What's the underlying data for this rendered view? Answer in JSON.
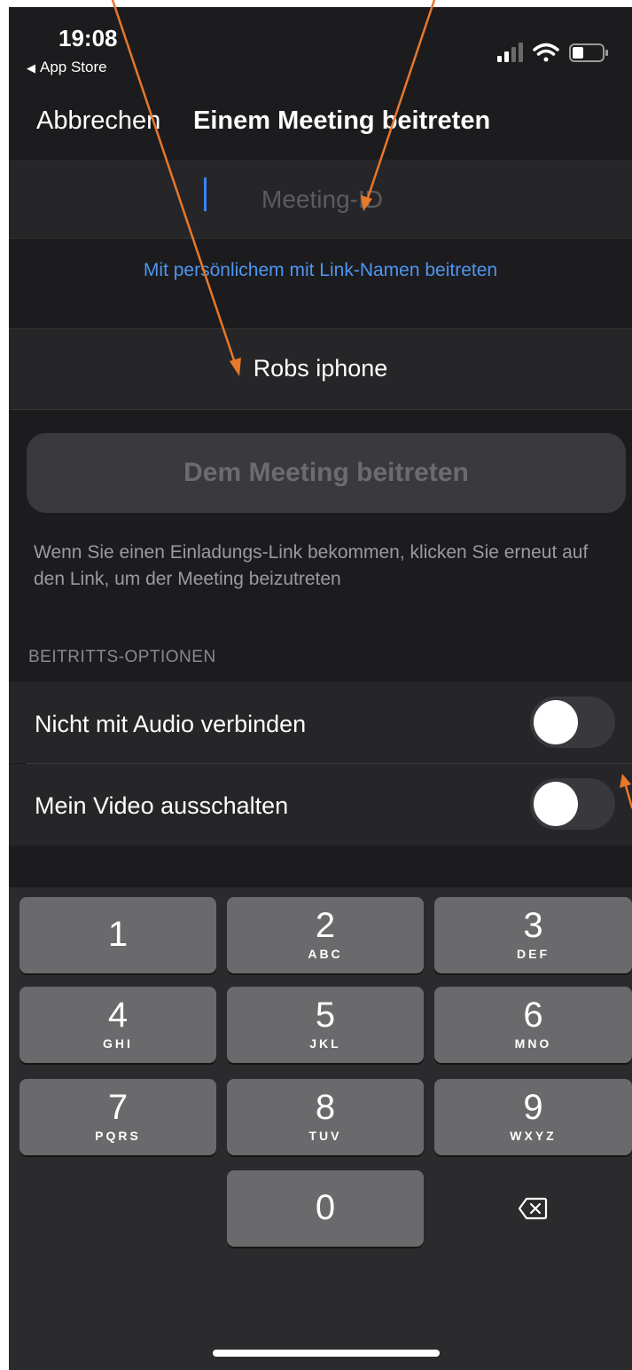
{
  "status_bar": {
    "time": "19:08",
    "back_label": "App Store",
    "back_icon": "◀"
  },
  "nav": {
    "cancel_label": "Abbrechen",
    "title": "Einem Meeting beitreten"
  },
  "meeting_id": {
    "placeholder": "Meeting-ID",
    "value": ""
  },
  "link_name_label": "Mit persönlichem mit Link-Namen beitreten",
  "display_name": "Robs iphone",
  "join_button_label": "Dem Meeting beitreten",
  "hint_text": "Wenn Sie einen Einladungs-Link bekommen, klicken Sie erneut auf den Link, um der Meeting beizutreten",
  "options": {
    "header": "BEITRITTS-OPTIONEN",
    "items": [
      {
        "label": "Nicht mit Audio verbinden",
        "enabled": false
      },
      {
        "label": "Mein Video ausschalten",
        "enabled": false
      }
    ]
  },
  "keypad": {
    "keys": [
      {
        "digit": "1",
        "letters": ""
      },
      {
        "digit": "2",
        "letters": "ABC"
      },
      {
        "digit": "3",
        "letters": "DEF"
      },
      {
        "digit": "4",
        "letters": "GHI"
      },
      {
        "digit": "5",
        "letters": "JKL"
      },
      {
        "digit": "6",
        "letters": "MNO"
      },
      {
        "digit": "7",
        "letters": "PQRS"
      },
      {
        "digit": "8",
        "letters": "TUV"
      },
      {
        "digit": "9",
        "letters": "WXYZ"
      },
      {
        "digit": "0",
        "letters": ""
      }
    ],
    "backspace_icon": "backspace-icon"
  },
  "colors": {
    "accent": "#4f95f0",
    "annotation_arrow": "#e8782a",
    "background": "#1c1c1e"
  }
}
